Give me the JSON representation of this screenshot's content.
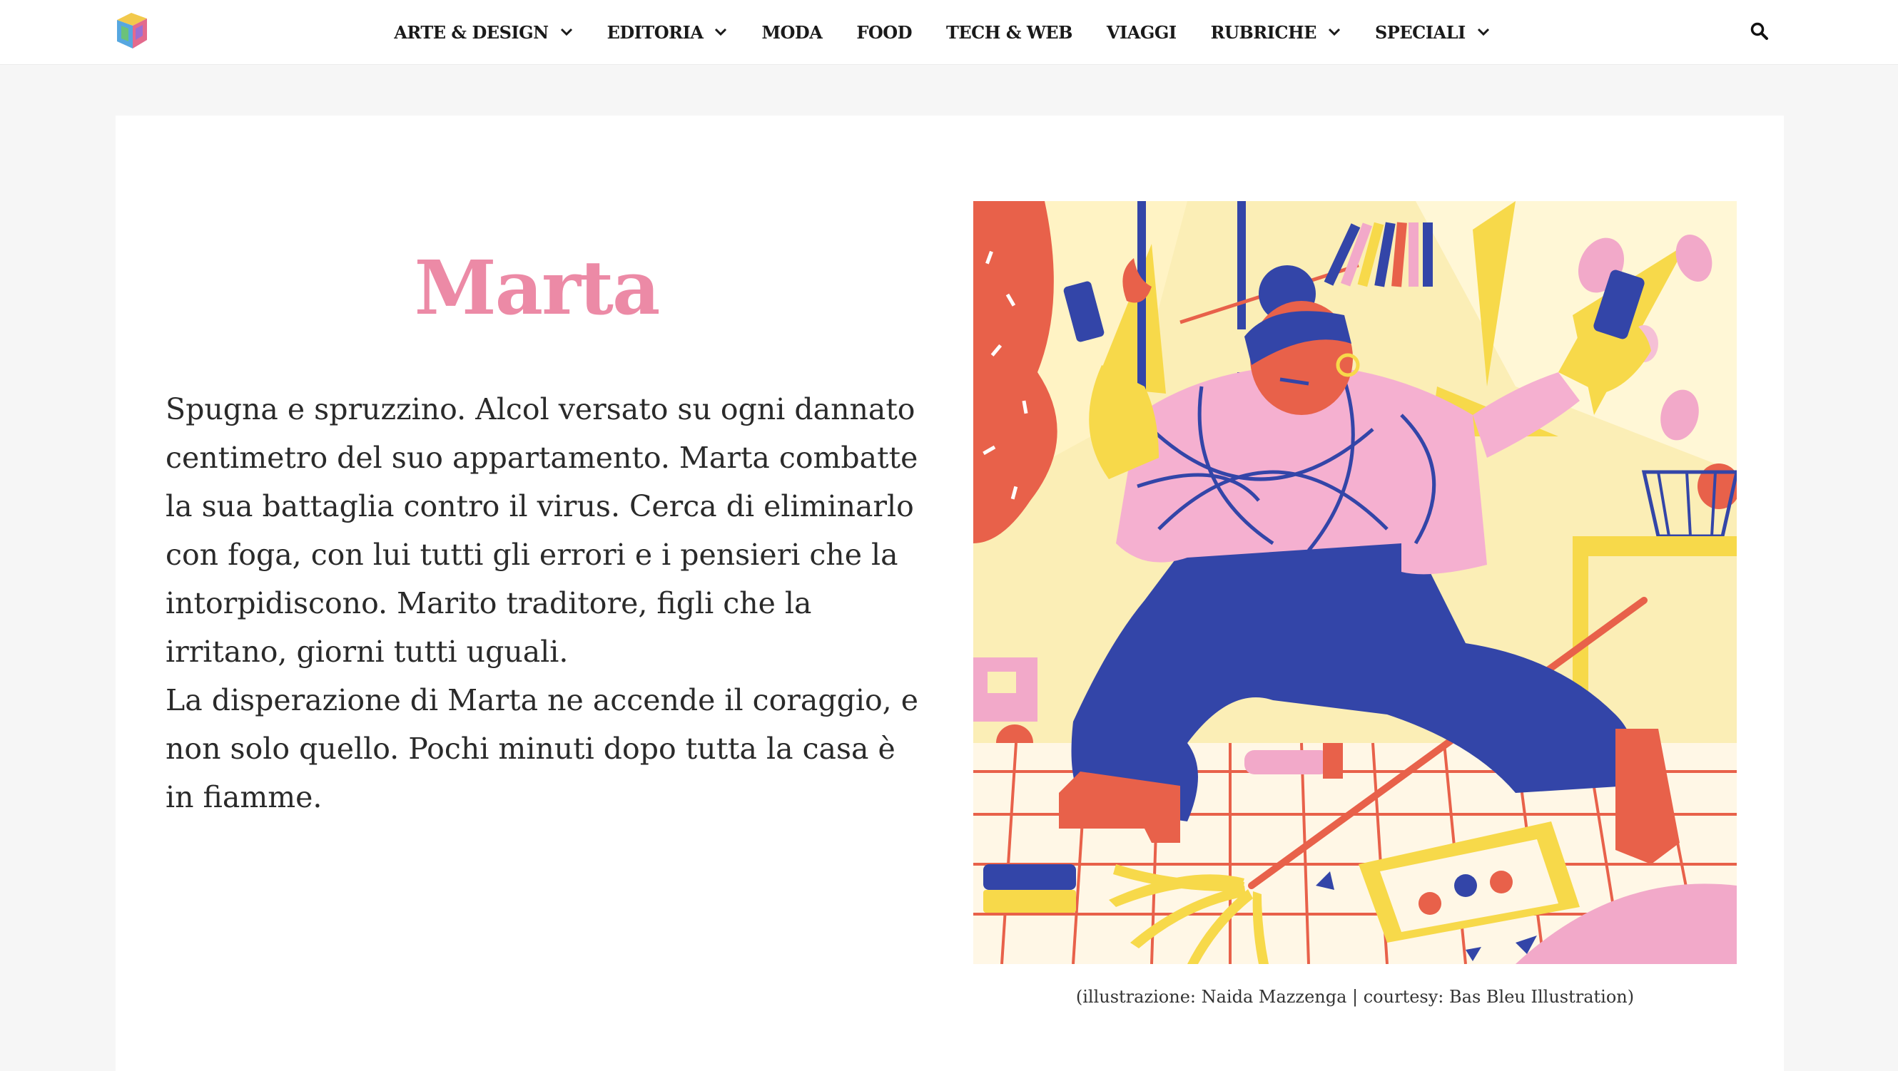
{
  "header": {
    "logo_icon": "cube-logo-icon",
    "nav": [
      {
        "label": "ARTE & DESIGN",
        "dropdown": true
      },
      {
        "label": "EDITORIA",
        "dropdown": true
      },
      {
        "label": "MODA",
        "dropdown": false
      },
      {
        "label": "FOOD",
        "dropdown": false
      },
      {
        "label": "TECH & WEB",
        "dropdown": false
      },
      {
        "label": "VIAGGI",
        "dropdown": false
      },
      {
        "label": "RUBRICHE",
        "dropdown": true
      },
      {
        "label": "SPECIALI",
        "dropdown": true
      }
    ],
    "search_icon": "search-icon"
  },
  "story": {
    "title": "Marta",
    "paragraph_1": "Spugna e spruzzino. Alcol versato su ogni dannato centimetro del suo appartamento. Marta combatte la sua battaglia contro il virus. Cerca di eliminarlo con foga, con lui tutti gli errori e i pensieri che la intorpidiscono. Marito traditore, figli che la irritano, giorni tutti uguali.",
    "paragraph_2": "La disperazione di Marta ne accende il coraggio, e non solo quello. Pochi minuti dopo tutta la casa è in fiamme.",
    "caption": "(illustrazione: Naida Mazzenga | courtesy: Bas Bleu Illustration)"
  },
  "colors": {
    "title_pink": "#ec8aa6",
    "page_background": "#f6f6f6",
    "card_background": "#ffffff",
    "illustration_blue": "#3345a8",
    "illustration_yellow": "#f7d94a",
    "illustration_pink": "#f2a9c9",
    "illustration_red": "#e8614a"
  }
}
